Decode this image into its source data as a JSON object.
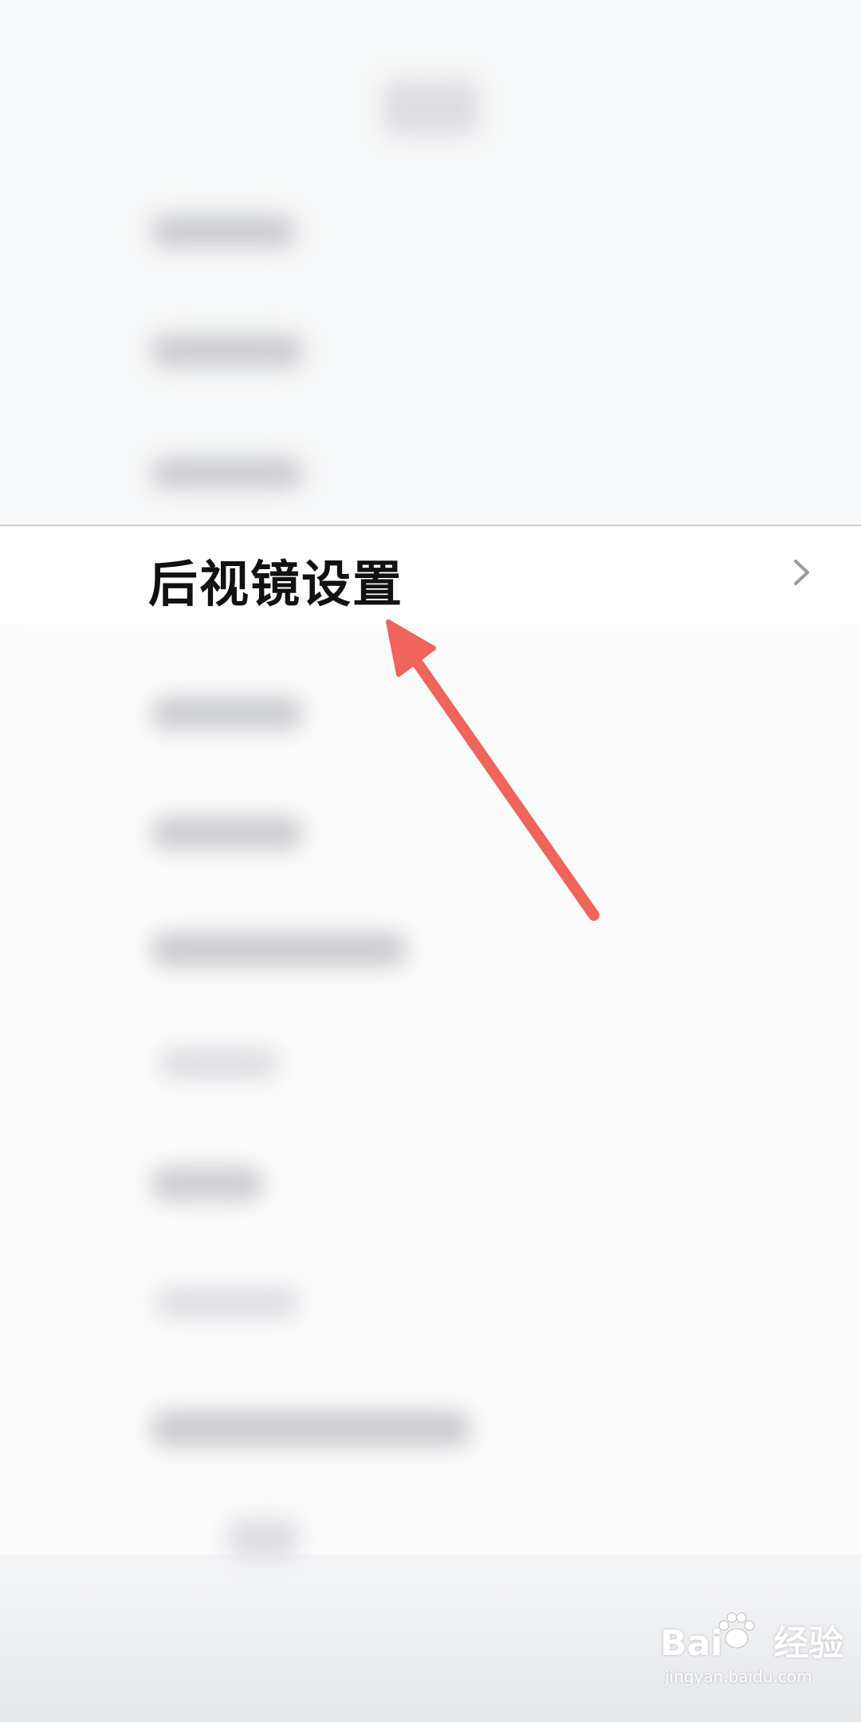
{
  "settings_row": {
    "label": "后视镜设置",
    "chevron_icon": "chevron-right-icon"
  },
  "annotation": {
    "arrow_icon": "arrow-pointer-icon",
    "color": "#f0645c"
  },
  "watermark": {
    "brand_left": "Bai",
    "brand_right": "经验",
    "site": "jingyan.baidu.com"
  }
}
